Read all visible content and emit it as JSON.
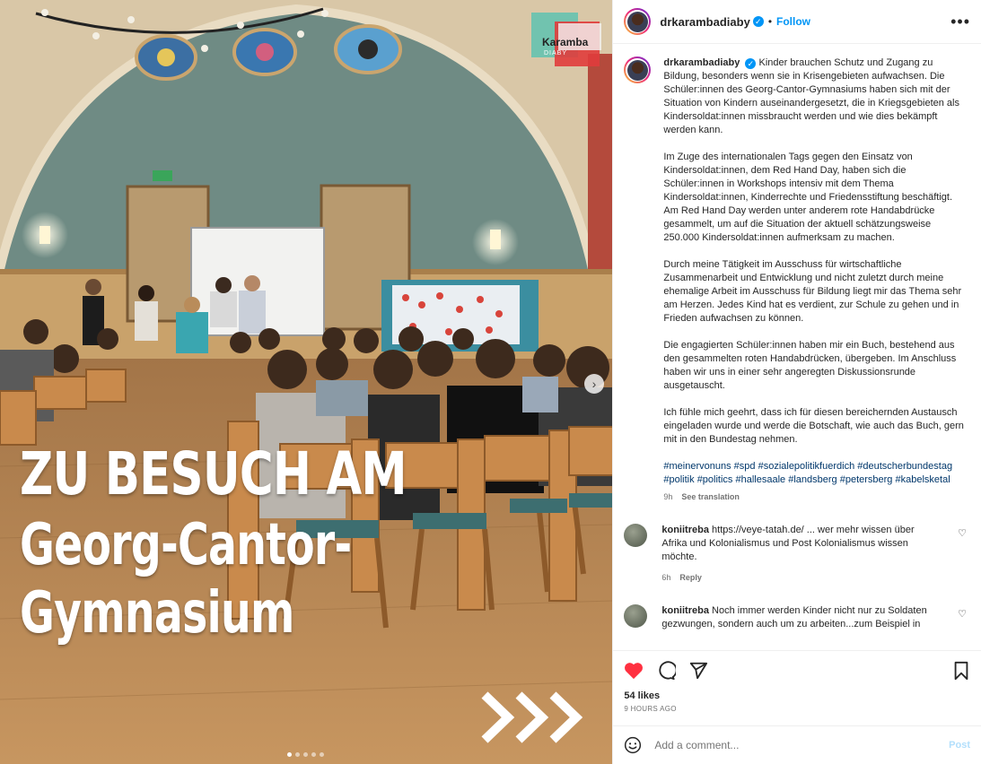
{
  "post": {
    "username": "drkarambadiaby",
    "verified": true,
    "follow_label": "Follow",
    "separator": "•",
    "more_label": "•••"
  },
  "image": {
    "headline": [
      "ZU BESUCH AM",
      "Georg-Cantor-",
      "Gymnasium"
    ],
    "brand_name": "Karamba",
    "brand_sub": "DIABY",
    "carousel_count": 5,
    "carousel_active": 0,
    "next_label": "›"
  },
  "caption": {
    "username": "drkarambadiaby",
    "paragraphs": [
      "Kinder brauchen Schutz und Zugang zu Bildung, besonders wenn sie in Krisengebieten aufwachsen. Die Schüler:innen des Georg-Cantor-Gymnasiums haben sich mit der Situation von Kindern auseinandergesetzt, die in Kriegsgebieten als Kindersoldat:innen missbraucht werden und wie dies bekämpft werden kann.",
      "Im Zuge des internationalen Tags gegen den Einsatz von Kindersoldat:innen, dem Red Hand Day, haben sich die Schüler:innen in Workshops intensiv mit dem Thema Kindersoldat:innen, Kinderrechte und Friedensstiftung beschäftigt. Am Red Hand Day werden unter anderem rote Handabdrücke gesammelt, um auf die Situation der aktuell schätzungsweise 250.000 Kindersoldat:innen aufmerksam zu machen.",
      "Durch meine Tätigkeit im Ausschuss für wirtschaftliche Zusammenarbeit und Entwicklung und nicht zuletzt durch meine ehemalige Arbeit im Ausschuss für Bildung liegt mir das Thema sehr am Herzen. Jedes Kind hat es verdient, zur Schule zu gehen und in Frieden aufwachsen zu können.",
      "Die engagierten Schüler:innen haben mir ein Buch, bestehend aus den gesammelten roten Handabdrücken, übergeben. Im Anschluss haben wir uns in einer sehr angeregten Diskussionsrunde ausgetauscht.",
      "Ich fühle mich geehrt, dass ich für diesen bereichernden Austausch eingeladen wurde und werde die Botschaft, wie auch das Buch, gern mit in den Bundestag nehmen."
    ],
    "hashtags": [
      "#meinervonuns",
      "#spd",
      "#sozialepolitikfuerdich",
      "#deutscherbundestag",
      "#politik",
      "#politics",
      "#hallesaale",
      "#landsberg",
      "#petersberg",
      "#kabelsketal"
    ],
    "age": "9h",
    "see_translation": "See translation"
  },
  "comments": [
    {
      "username": "koniitreba",
      "text": "https://veye-tatah.de/ ... wer mehr wissen über Afrika und Kolonialismus und Post Kolonialismus wissen möchte.",
      "age": "6h",
      "reply": "Reply"
    },
    {
      "username": "koniitreba",
      "text": "Noch immer werden Kinder nicht nur zu Soldaten gezwungen, sondern auch um zu arbeiten...zum Beispiel in",
      "age": "",
      "reply": ""
    }
  ],
  "footer": {
    "likes": "54 likes",
    "time": "9 HOURS AGO",
    "add_placeholder": "Add a comment...",
    "post_label": "Post",
    "liked": true
  },
  "colors": {
    "accent": "#0095f6",
    "like_red": "#ff3040",
    "hashtag": "#00376b",
    "muted": "#737373"
  }
}
